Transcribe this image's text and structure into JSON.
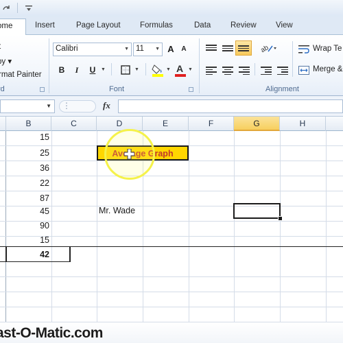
{
  "ribbon_tabs": [
    "ome",
    "Insert",
    "Page Layout",
    "Formulas",
    "Data",
    "Review",
    "View"
  ],
  "clipboard": {
    "cut": "t",
    "copy": "py ▾",
    "format_painter": "rmat Painter",
    "group_label": "rd"
  },
  "font": {
    "name": "Calibri",
    "size": "11",
    "group_label": "Font",
    "bold": "B",
    "italic": "I",
    "underline": "U",
    "grow": "A",
    "shrink": "A"
  },
  "alignment": {
    "wrap_text": "Wrap Te",
    "merge": "Merge &",
    "group_label": "Alignment"
  },
  "formula_bar": {
    "fx": "fx",
    "value": ""
  },
  "columns": [
    "B",
    "C",
    "D",
    "E",
    "F",
    "G",
    "H"
  ],
  "selected_column": "G",
  "column_b_values": [
    "15",
    "25",
    "36",
    "22",
    "87",
    "45",
    "90",
    "15",
    "42"
  ],
  "cells": {
    "title": "Average Graph",
    "name": "Mr. Wade"
  },
  "watermark": "ast-O-Matic.com",
  "colors": {
    "title_fill": "#ffd700",
    "title_text": "#c0392b",
    "selected_header": "#f7cf5e",
    "highlight_ring": "#f5f24a"
  }
}
